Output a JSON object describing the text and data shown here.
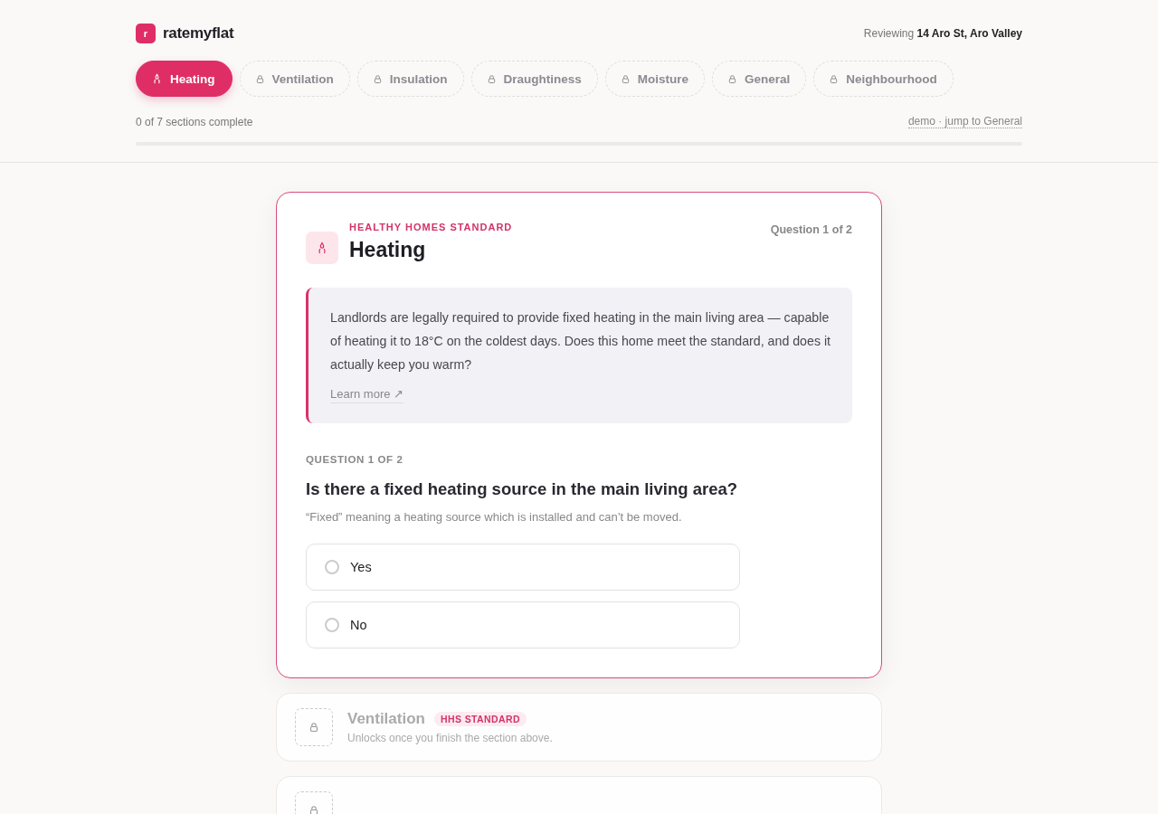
{
  "brand": {
    "logo_letter": "r",
    "name": "ratemyflat"
  },
  "reviewing": {
    "label": "Reviewing",
    "address": "14 Aro St, Aro Valley"
  },
  "tabs": [
    {
      "label": "Heating",
      "selected": true,
      "locked": false
    },
    {
      "label": "Ventilation",
      "selected": false,
      "locked": true
    },
    {
      "label": "Insulation",
      "selected": false,
      "locked": true
    },
    {
      "label": "Draughtiness",
      "selected": false,
      "locked": true
    },
    {
      "label": "Moisture",
      "selected": false,
      "locked": true
    },
    {
      "label": "General",
      "selected": false,
      "locked": true
    },
    {
      "label": "Neighbourhood",
      "selected": false,
      "locked": true
    }
  ],
  "progress": {
    "text": "0 of 7 sections complete",
    "demo_link": "demo · jump to General",
    "level": 0
  },
  "section": {
    "eyebrow": "HEALTHY HOMES STANDARD",
    "title": "Heating",
    "counter": "Question 1 of 2",
    "info": "Landlords are legally required to provide fixed heating in the main living area — capable of heating it to 18°C on the coldest days. Does this home meet the standard, and does it actually keep you warm?",
    "learn_more": "Learn more ↗",
    "question_label": "QUESTION 1 OF 2",
    "question": "Is there a fixed heating source in the main living area?",
    "hint": "“Fixed” meaning a heating source which is installed and can’t be moved.",
    "options": [
      {
        "label": "Yes",
        "selected": false
      },
      {
        "label": "No",
        "selected": false
      }
    ]
  },
  "locked_sections": [
    {
      "kind": "locked",
      "title": "Ventilation",
      "badge": "HHS STANDARD",
      "note": "Unlocks once you finish the section above."
    },
    {
      "kind": "locked"
    }
  ]
}
